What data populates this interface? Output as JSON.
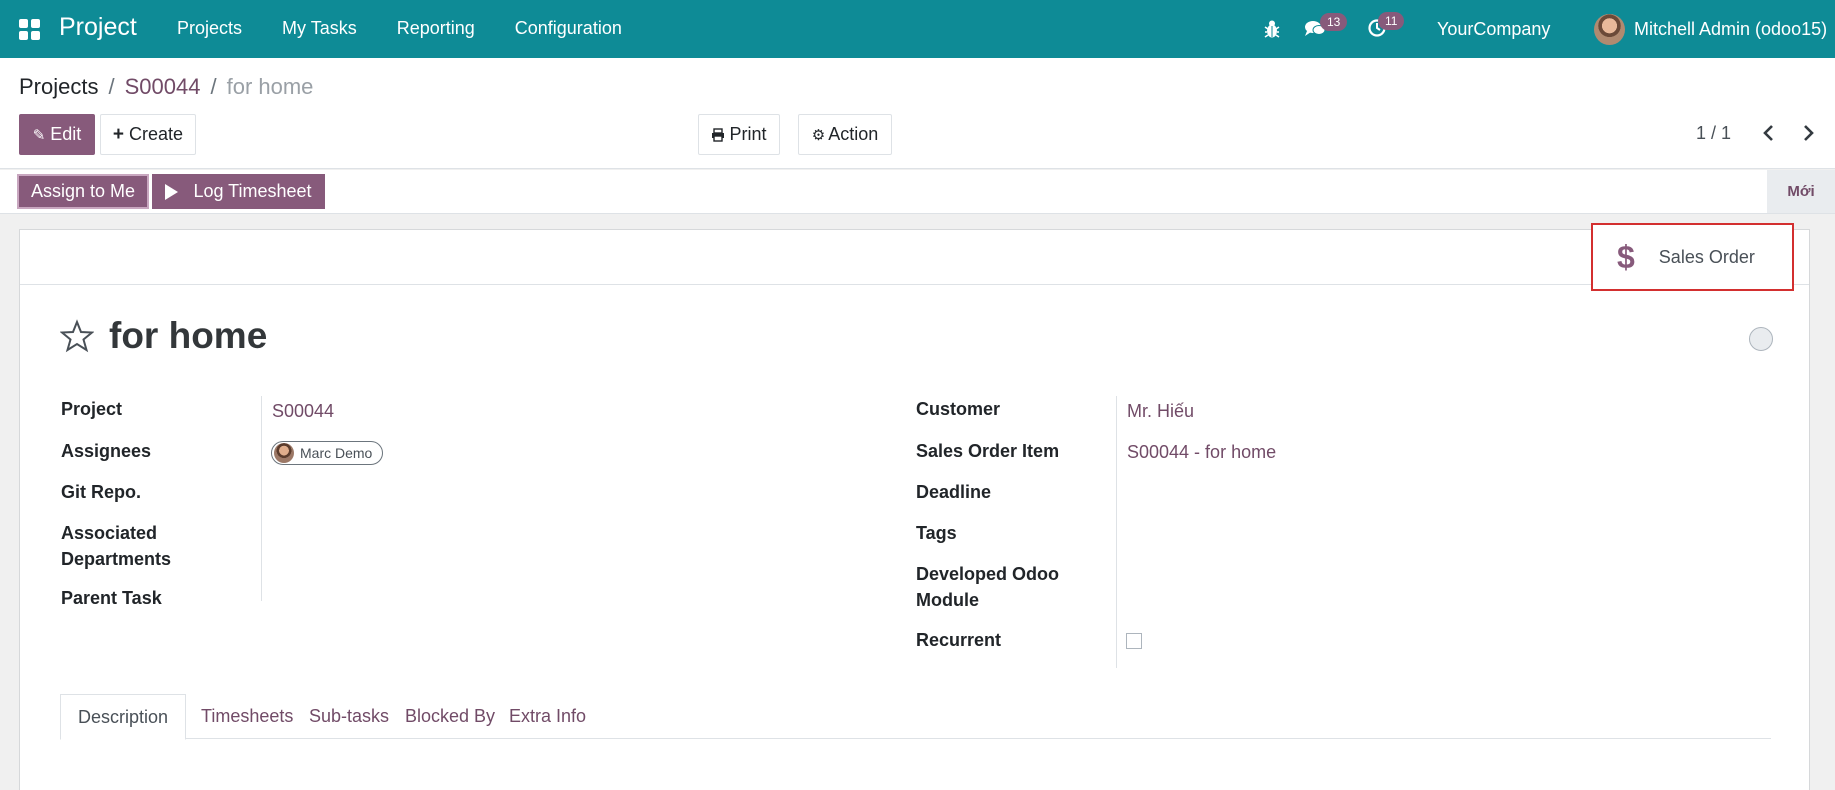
{
  "navbar": {
    "brand": "Project",
    "menu": [
      "Projects",
      "My Tasks",
      "Reporting",
      "Configuration"
    ],
    "messages_count": "13",
    "activities_count": "11",
    "company": "YourCompany",
    "user": "Mitchell Admin (odoo15)"
  },
  "breadcrumb": {
    "root": "Projects",
    "separator": "/",
    "parent": "S00044",
    "current": "for home"
  },
  "toolbar": {
    "edit": "Edit",
    "create": "Create",
    "print": "Print",
    "action": "Action",
    "pager": "1 / 1"
  },
  "statusbar": {
    "assign": "Assign to Me",
    "log_timesheet": "Log Timesheet",
    "stage": "Mới"
  },
  "smart_button": {
    "label": "Sales Order",
    "icon": "dollar-icon"
  },
  "task": {
    "title": "for home"
  },
  "left_fields": {
    "project_label": "Project",
    "project_value": "S00044",
    "assignees_label": "Assignees",
    "assignee": "Marc Demo",
    "git_label": "Git Repo.",
    "dept_label_1": "Associated",
    "dept_label_2": "Departments",
    "parent_label": "Parent Task"
  },
  "right_fields": {
    "customer_label": "Customer",
    "customer_value": "Mr. Hiếu",
    "so_item_label": "Sales Order Item",
    "so_item_value": "S00044 - for home",
    "deadline_label": "Deadline",
    "tags_label": "Tags",
    "module_label_1": "Developed Odoo",
    "module_label_2": "Module",
    "recurrent_label": "Recurrent"
  },
  "tabs": [
    "Description",
    "Timesheets",
    "Sub-tasks",
    "Blocked By",
    "Extra Info"
  ],
  "colors": {
    "navbar": "#0e8b96",
    "primary": "#875a7b",
    "link": "#714b67",
    "highlight": "#d32f2f"
  }
}
